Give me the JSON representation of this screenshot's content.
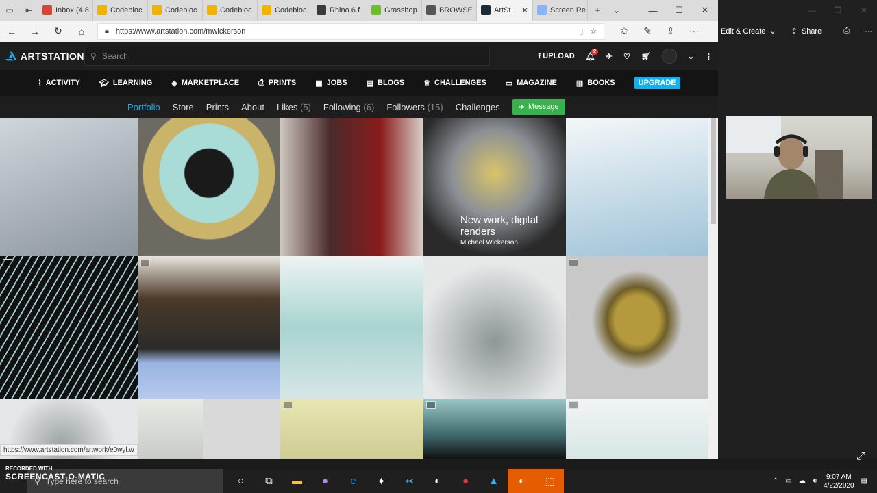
{
  "browser": {
    "tabs": [
      {
        "title": "Inbox (4,8",
        "color": "#d44638",
        "glyph": "M"
      },
      {
        "title": "Codebloc",
        "color": "#f0b400",
        "glyph": ""
      },
      {
        "title": "Codebloc",
        "color": "#f0b400",
        "glyph": ""
      },
      {
        "title": "Codebloc",
        "color": "#f0b400",
        "glyph": ""
      },
      {
        "title": "Codebloc",
        "color": "#f0b400",
        "glyph": ""
      },
      {
        "title": "Rhino 6 f",
        "color": "#3a3a3a",
        "glyph": ""
      },
      {
        "title": "Grasshop",
        "color": "#6cbf2a",
        "glyph": ""
      },
      {
        "title": "BROWSE",
        "color": "#555555",
        "glyph": ""
      },
      {
        "title": "ArtSt",
        "color": "#1e2a38",
        "glyph": ""
      },
      {
        "title": "Screen Re",
        "color": "#8ab4f8",
        "glyph": ""
      }
    ],
    "url": "https://www.artstation.com/mwickerson",
    "side_actions": {
      "edit_create": "Edit & Create",
      "share": "Share"
    }
  },
  "artstation": {
    "logo": "ARTSTATION",
    "search_placeholder": "Search",
    "upload": "UPLOAD",
    "notif_count": "2",
    "nav": [
      "ACTIVITY",
      "LEARNING",
      "MARKETPLACE",
      "PRINTS",
      "JOBS",
      "BLOGS",
      "CHALLENGES",
      "MAGAZINE",
      "BOOKS"
    ],
    "upgrade": "UPGRADE",
    "subnav": {
      "portfolio": "Portfolio",
      "store": "Store",
      "prints": "Prints",
      "about": "About",
      "likes": "Likes",
      "likes_count": "(5)",
      "following": "Following",
      "following_count": "(6)",
      "followers": "Followers",
      "followers_count": "(15)",
      "challenges": "Challenges",
      "message": "Message"
    },
    "hover": {
      "title": "New work, digital renders",
      "author": "Michael Wickerson"
    },
    "status_url": "https://www.artstation.com/artwork/e0wyl.w",
    "accent": "#13aff0"
  },
  "taskbar": {
    "search": "Type here to search",
    "time": "9:07 AM",
    "date": "4/22/2020"
  },
  "watermark": {
    "recorded_with": "RECORDED WITH",
    "brand": "SCREENCAST-O-MATIC"
  }
}
